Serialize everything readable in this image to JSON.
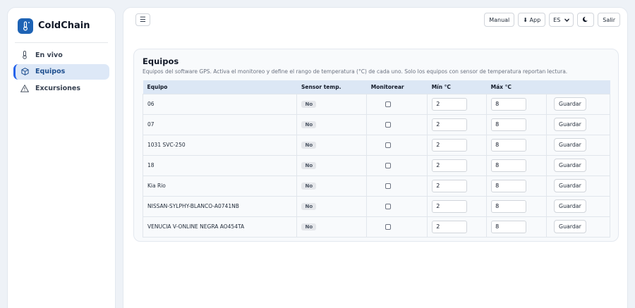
{
  "brand": {
    "name": "ColdChain",
    "logo_icon": "thermometer-snowflake-icon"
  },
  "sidebar": {
    "items": [
      {
        "label": "En vivo",
        "icon": "thermometer-icon",
        "active": false
      },
      {
        "label": "Equipos",
        "icon": "box-icon",
        "active": true
      },
      {
        "label": "Excursiones",
        "icon": "warning-triangle-icon",
        "active": false
      }
    ]
  },
  "topbar": {
    "menu_glyph": "☰",
    "manual_label": "Manual",
    "app_label": "⬇ App",
    "lang_value": "ES",
    "theme_icon": "moon-icon",
    "exit_label": "Salir"
  },
  "card": {
    "title": "Equipos",
    "subtitle": "Equipos del software GPS. Activa el monitoreo y define el rango de temperatura (°C) de cada uno. Solo los equipos con sensor de temperatura reportan lectura."
  },
  "table": {
    "headers": [
      "Equipo",
      "Sensor temp.",
      "Monitorear",
      "Mín °C",
      "Máx °C",
      ""
    ],
    "save_label": "Guardar",
    "rows": [
      {
        "equipo": "06",
        "sensor": "No",
        "monitor": false,
        "min": "2",
        "max": "8"
      },
      {
        "equipo": "07",
        "sensor": "No",
        "monitor": false,
        "min": "2",
        "max": "8"
      },
      {
        "equipo": "1031 SVC-250",
        "sensor": "No",
        "monitor": false,
        "min": "2",
        "max": "8"
      },
      {
        "equipo": "18",
        "sensor": "No",
        "monitor": false,
        "min": "2",
        "max": "8"
      },
      {
        "equipo": "Kia Rio",
        "sensor": "No",
        "monitor": false,
        "min": "2",
        "max": "8"
      },
      {
        "equipo": "NISSAN-SYLPHY-BLANCO-A0741NB",
        "sensor": "No",
        "monitor": false,
        "min": "2",
        "max": "8"
      },
      {
        "equipo": "VENUCIA V-ONLINE NEGRA AO454TA",
        "sensor": "No",
        "monitor": false,
        "min": "2",
        "max": "8"
      }
    ]
  },
  "colors": {
    "accent": "#2563eb",
    "active_bg": "#dde8f7",
    "header_bg": "#dce7f5",
    "brand": "#1e63b5"
  }
}
